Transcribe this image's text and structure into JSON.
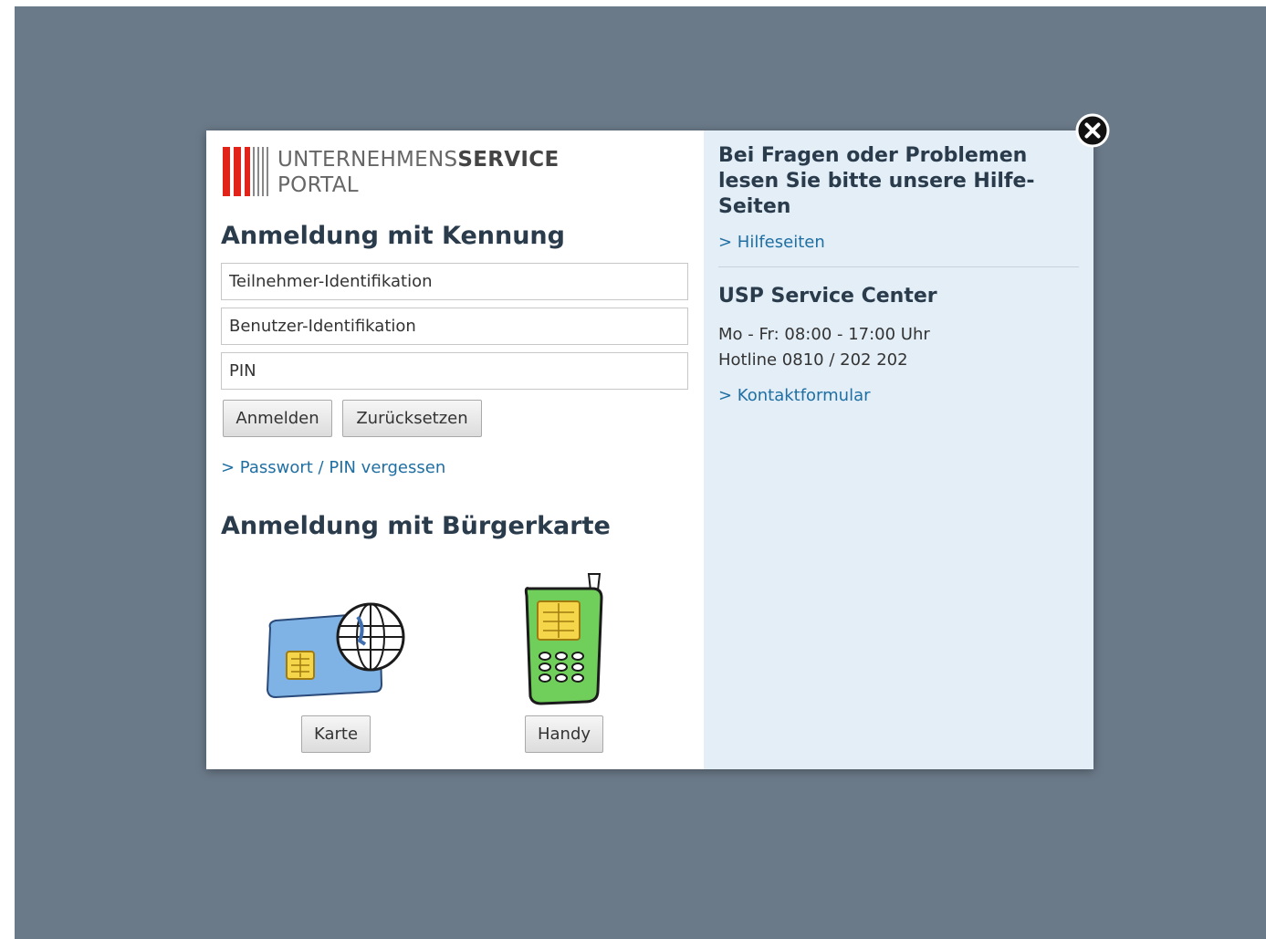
{
  "logo": {
    "line1_light": "UNTERNEHMENS",
    "line1_bold": "SERVICE",
    "line2": "PORTAL"
  },
  "login_id": {
    "heading": "Anmeldung mit Kennung",
    "participant_placeholder": "Teilnehmer-Identifikation",
    "user_placeholder": "Benutzer-Identifikation",
    "pin_placeholder": "PIN",
    "login_button": "Anmelden",
    "reset_button": "Zurücksetzen",
    "forgot_link": "> Passwort / PIN vergessen"
  },
  "login_card": {
    "heading": "Anmeldung mit Bürgerkarte",
    "card_button": "Karte",
    "phone_button": "Handy"
  },
  "help": {
    "heading": "Bei Fragen oder Problemen lesen Sie bitte unsere Hilfe-Seiten",
    "help_link": "> Hilfeseiten",
    "service_heading": "USP Service Center",
    "hours": "Mo - Fr: 08:00 - 17:00 Uhr",
    "hotline": "Hotline 0810 / 202 202",
    "contact_link": "> Kontaktformular"
  },
  "colors": {
    "backdrop": "#6b7a89",
    "help_panel": "#e3eef7",
    "link": "#1f6fa3",
    "logo_red": "#e2231a",
    "heading": "#2a3b4c"
  }
}
